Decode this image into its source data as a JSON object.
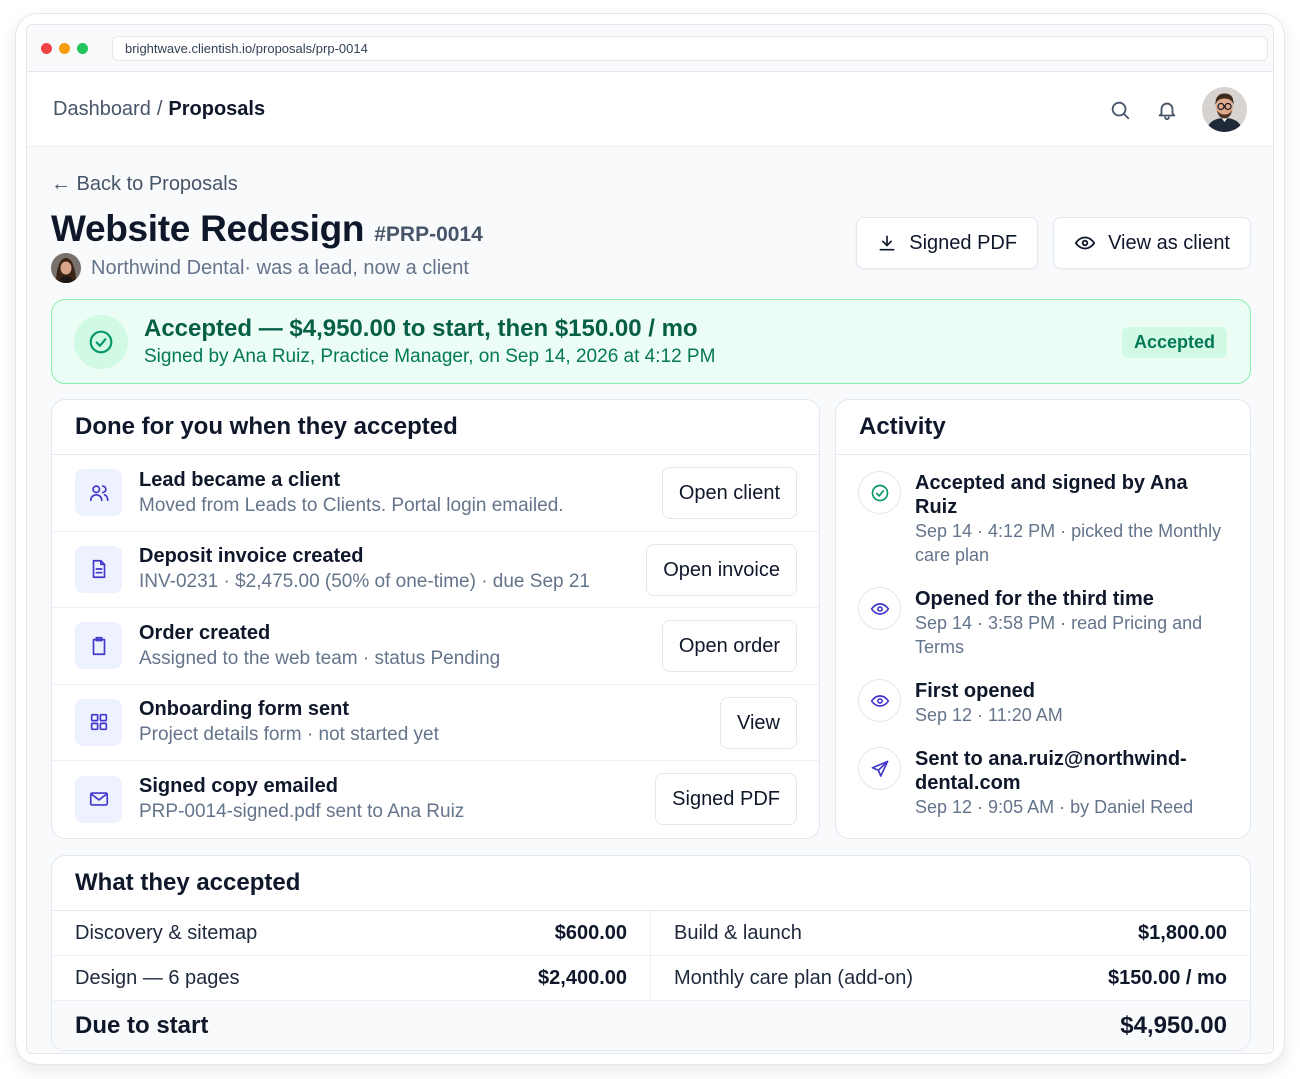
{
  "browser": {
    "url": "brightwave.clientish.io/proposals/prp-0014"
  },
  "header": {
    "crumb_root": "Dashboard",
    "crumb_sep": "/",
    "crumb_current": "Proposals"
  },
  "page": {
    "back_link": "← Back to Proposals",
    "title": "Website Redesign",
    "id": "#PRP-0014",
    "client_name": "Northwind Dental",
    "client_note": " · was a lead, now a client",
    "signed_pdf_label": "Signed PDF",
    "view_as_client_label": "View as client"
  },
  "banner": {
    "headline": "Accepted — $4,950.00 to start, then $150.00 / mo",
    "subline": "Signed by Ana Ruiz, Practice Manager, on Sep 14, 2026 at 4:12 PM",
    "badge": "Accepted",
    "accent_color": "#059669"
  },
  "done": {
    "title": "Done for you when they accepted",
    "items": [
      {
        "icon": "users-icon",
        "title": "Lead became a client",
        "sub": "Moved from Leads to Clients. Portal login emailed.",
        "action": "Open client"
      },
      {
        "icon": "document-icon",
        "title": "Deposit invoice created",
        "sub": "INV-0231 · $2,475.00 (50% of one-time) · due Sep 21",
        "action": "Open invoice"
      },
      {
        "icon": "clipboard-icon",
        "title": "Order created",
        "sub": "Assigned to the web team · status Pending",
        "action": "Open order"
      },
      {
        "icon": "grid-icon",
        "title": "Onboarding form sent",
        "sub": "Project details form · not started yet",
        "action": "View"
      },
      {
        "icon": "mail-icon",
        "title": "Signed copy emailed",
        "sub": "PRP-0014-signed.pdf sent to Ana Ruiz",
        "action": "Signed PDF"
      }
    ]
  },
  "activity": {
    "title": "Activity",
    "items": [
      {
        "icon": "check-circle-icon",
        "title": "Accepted and signed by Ana Ruiz",
        "sub": "Sep 14 · 4:12 PM · picked the Monthly care plan"
      },
      {
        "icon": "eye-icon",
        "title": "Opened for the third time",
        "sub": "Sep 14 · 3:58 PM · read Pricing and Terms"
      },
      {
        "icon": "eye-icon",
        "title": "First opened",
        "sub": "Sep 12 · 11:20 AM"
      },
      {
        "icon": "send-icon",
        "title": "Sent to ana.ruiz@northwind-dental.com",
        "sub": "Sep 12 · 9:05 AM · by Daniel Reed"
      }
    ]
  },
  "accepted": {
    "title": "What they accepted",
    "rows": [
      [
        {
          "label": "Discovery & sitemap",
          "value": "$600.00"
        },
        {
          "label": "Build & launch",
          "value": "$1,800.00"
        }
      ],
      [
        {
          "label": "Design — 6 pages",
          "value": "$2,400.00"
        },
        {
          "label": "Monthly care plan (add-on)",
          "value": "$150.00 / mo"
        }
      ]
    ],
    "total_label": "Due to start",
    "total_value": "$4,950.00"
  }
}
